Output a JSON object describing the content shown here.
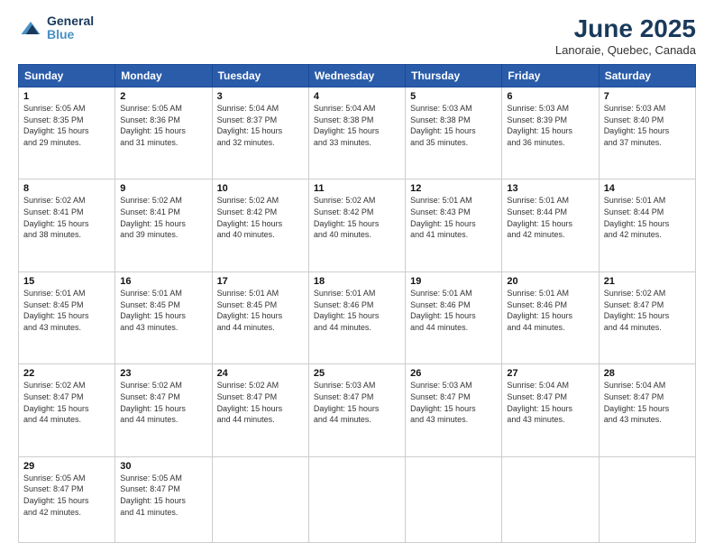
{
  "logo": {
    "line1": "General",
    "line2": "Blue"
  },
  "title": "June 2025",
  "subtitle": "Lanoraie, Quebec, Canada",
  "days_header": [
    "Sunday",
    "Monday",
    "Tuesday",
    "Wednesday",
    "Thursday",
    "Friday",
    "Saturday"
  ],
  "weeks": [
    [
      {
        "day": "1",
        "info": "Sunrise: 5:05 AM\nSunset: 8:35 PM\nDaylight: 15 hours\nand 29 minutes."
      },
      {
        "day": "2",
        "info": "Sunrise: 5:05 AM\nSunset: 8:36 PM\nDaylight: 15 hours\nand 31 minutes."
      },
      {
        "day": "3",
        "info": "Sunrise: 5:04 AM\nSunset: 8:37 PM\nDaylight: 15 hours\nand 32 minutes."
      },
      {
        "day": "4",
        "info": "Sunrise: 5:04 AM\nSunset: 8:38 PM\nDaylight: 15 hours\nand 33 minutes."
      },
      {
        "day": "5",
        "info": "Sunrise: 5:03 AM\nSunset: 8:38 PM\nDaylight: 15 hours\nand 35 minutes."
      },
      {
        "day": "6",
        "info": "Sunrise: 5:03 AM\nSunset: 8:39 PM\nDaylight: 15 hours\nand 36 minutes."
      },
      {
        "day": "7",
        "info": "Sunrise: 5:03 AM\nSunset: 8:40 PM\nDaylight: 15 hours\nand 37 minutes."
      }
    ],
    [
      {
        "day": "8",
        "info": "Sunrise: 5:02 AM\nSunset: 8:41 PM\nDaylight: 15 hours\nand 38 minutes."
      },
      {
        "day": "9",
        "info": "Sunrise: 5:02 AM\nSunset: 8:41 PM\nDaylight: 15 hours\nand 39 minutes."
      },
      {
        "day": "10",
        "info": "Sunrise: 5:02 AM\nSunset: 8:42 PM\nDaylight: 15 hours\nand 40 minutes."
      },
      {
        "day": "11",
        "info": "Sunrise: 5:02 AM\nSunset: 8:42 PM\nDaylight: 15 hours\nand 40 minutes."
      },
      {
        "day": "12",
        "info": "Sunrise: 5:01 AM\nSunset: 8:43 PM\nDaylight: 15 hours\nand 41 minutes."
      },
      {
        "day": "13",
        "info": "Sunrise: 5:01 AM\nSunset: 8:44 PM\nDaylight: 15 hours\nand 42 minutes."
      },
      {
        "day": "14",
        "info": "Sunrise: 5:01 AM\nSunset: 8:44 PM\nDaylight: 15 hours\nand 42 minutes."
      }
    ],
    [
      {
        "day": "15",
        "info": "Sunrise: 5:01 AM\nSunset: 8:45 PM\nDaylight: 15 hours\nand 43 minutes."
      },
      {
        "day": "16",
        "info": "Sunrise: 5:01 AM\nSunset: 8:45 PM\nDaylight: 15 hours\nand 43 minutes."
      },
      {
        "day": "17",
        "info": "Sunrise: 5:01 AM\nSunset: 8:45 PM\nDaylight: 15 hours\nand 44 minutes."
      },
      {
        "day": "18",
        "info": "Sunrise: 5:01 AM\nSunset: 8:46 PM\nDaylight: 15 hours\nand 44 minutes."
      },
      {
        "day": "19",
        "info": "Sunrise: 5:01 AM\nSunset: 8:46 PM\nDaylight: 15 hours\nand 44 minutes."
      },
      {
        "day": "20",
        "info": "Sunrise: 5:01 AM\nSunset: 8:46 PM\nDaylight: 15 hours\nand 44 minutes."
      },
      {
        "day": "21",
        "info": "Sunrise: 5:02 AM\nSunset: 8:47 PM\nDaylight: 15 hours\nand 44 minutes."
      }
    ],
    [
      {
        "day": "22",
        "info": "Sunrise: 5:02 AM\nSunset: 8:47 PM\nDaylight: 15 hours\nand 44 minutes."
      },
      {
        "day": "23",
        "info": "Sunrise: 5:02 AM\nSunset: 8:47 PM\nDaylight: 15 hours\nand 44 minutes."
      },
      {
        "day": "24",
        "info": "Sunrise: 5:02 AM\nSunset: 8:47 PM\nDaylight: 15 hours\nand 44 minutes."
      },
      {
        "day": "25",
        "info": "Sunrise: 5:03 AM\nSunset: 8:47 PM\nDaylight: 15 hours\nand 44 minutes."
      },
      {
        "day": "26",
        "info": "Sunrise: 5:03 AM\nSunset: 8:47 PM\nDaylight: 15 hours\nand 43 minutes."
      },
      {
        "day": "27",
        "info": "Sunrise: 5:04 AM\nSunset: 8:47 PM\nDaylight: 15 hours\nand 43 minutes."
      },
      {
        "day": "28",
        "info": "Sunrise: 5:04 AM\nSunset: 8:47 PM\nDaylight: 15 hours\nand 43 minutes."
      }
    ],
    [
      {
        "day": "29",
        "info": "Sunrise: 5:05 AM\nSunset: 8:47 PM\nDaylight: 15 hours\nand 42 minutes."
      },
      {
        "day": "30",
        "info": "Sunrise: 5:05 AM\nSunset: 8:47 PM\nDaylight: 15 hours\nand 41 minutes."
      },
      {
        "day": "",
        "info": "",
        "empty": true
      },
      {
        "day": "",
        "info": "",
        "empty": true
      },
      {
        "day": "",
        "info": "",
        "empty": true
      },
      {
        "day": "",
        "info": "",
        "empty": true
      },
      {
        "day": "",
        "info": "",
        "empty": true
      }
    ]
  ]
}
